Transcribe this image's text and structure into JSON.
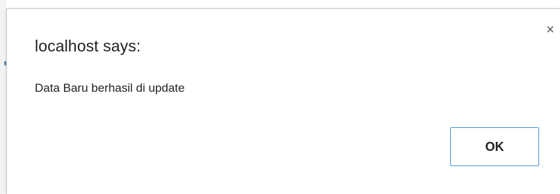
{
  "dialog": {
    "title": "localhost says:",
    "message": "Data Baru berhasil di update",
    "ok_label": "OK",
    "close_glyph": "×",
    "close_icon": "close-icon",
    "accent_color": "#4a90e2"
  }
}
